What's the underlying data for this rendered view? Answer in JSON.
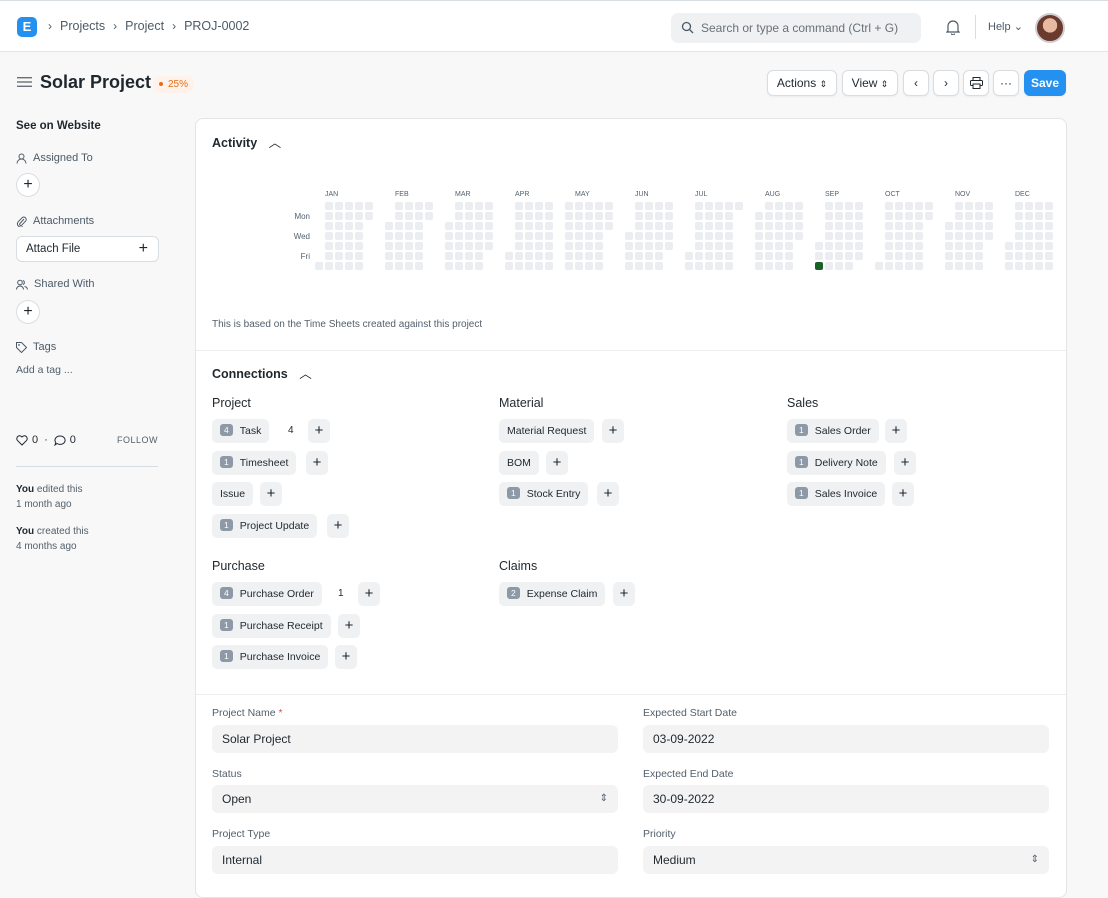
{
  "navbar": {
    "logo": "E",
    "breadcrumbs": [
      "Projects",
      "Project",
      "PROJ-0002"
    ],
    "search_placeholder": "Search or type a command (Ctrl + G)",
    "help": "Help"
  },
  "header": {
    "title": "Solar Project",
    "progress_badge": "25%",
    "actions_label": "Actions",
    "view_label": "View",
    "more_label": "···",
    "save_label": "Save"
  },
  "sidebar": {
    "see_on_website": "See on Website",
    "assigned_to": "Assigned To",
    "attachments": "Attachments",
    "attach_file": "Attach File",
    "shared_with": "Shared With",
    "tags": "Tags",
    "add_tag": "Add a tag ...",
    "likes": "0",
    "comments": "0",
    "follow": "FOLLOW",
    "activity": [
      {
        "who": "You",
        "what": " edited this",
        "when": "1 month ago"
      },
      {
        "who": "You",
        "what": " created this",
        "when": "4 months ago"
      }
    ]
  },
  "activity": {
    "title": "Activity",
    "months": [
      "JAN",
      "FEB",
      "MAR",
      "APR",
      "MAY",
      "JUN",
      "JUL",
      "AUG",
      "SEP",
      "OCT",
      "NOV",
      "DEC"
    ],
    "days": [
      "Mon",
      "Wed",
      "Fri"
    ],
    "note": "This is based on the Time Sheets created against this project",
    "empty_color": "#ebedf0",
    "active_color": "#196127",
    "active_cell": {
      "date": "2022-09-03"
    }
  },
  "connections": {
    "title": "Connections",
    "groups": [
      {
        "name": "Project",
        "items": [
          {
            "label": "Task",
            "count": "4",
            "extra": "4"
          },
          {
            "label": "Timesheet",
            "count": "1"
          },
          {
            "label": "Issue",
            "count": ""
          },
          {
            "label": "Project Update",
            "count": "1"
          }
        ]
      },
      {
        "name": "Material",
        "items": [
          {
            "label": "Material Request",
            "count": ""
          },
          {
            "label": "BOM",
            "count": ""
          },
          {
            "label": "Stock Entry",
            "count": "1"
          }
        ]
      },
      {
        "name": "Sales",
        "items": [
          {
            "label": "Sales Order",
            "count": "1"
          },
          {
            "label": "Delivery Note",
            "count": "1"
          },
          {
            "label": "Sales Invoice",
            "count": "1"
          }
        ]
      },
      {
        "name": "Purchase",
        "items": [
          {
            "label": "Purchase Order",
            "count": "4",
            "extra": "1"
          },
          {
            "label": "Purchase Receipt",
            "count": "1"
          },
          {
            "label": "Purchase Invoice",
            "count": "1"
          }
        ]
      },
      {
        "name": "Claims",
        "items": [
          {
            "label": "Expense Claim",
            "count": "2"
          }
        ]
      }
    ]
  },
  "form": {
    "project_name_label": "Project Name",
    "project_name": "Solar Project",
    "status_label": "Status",
    "status": "Open",
    "project_type_label": "Project Type",
    "project_type": "Internal",
    "start_label": "Expected Start Date",
    "start": "03-09-2022",
    "end_label": "Expected End Date",
    "end": "30-09-2022",
    "priority_label": "Priority",
    "priority": "Medium"
  },
  "colors": {
    "primary": "#2490ef",
    "badge_orange": "#e86c13"
  }
}
